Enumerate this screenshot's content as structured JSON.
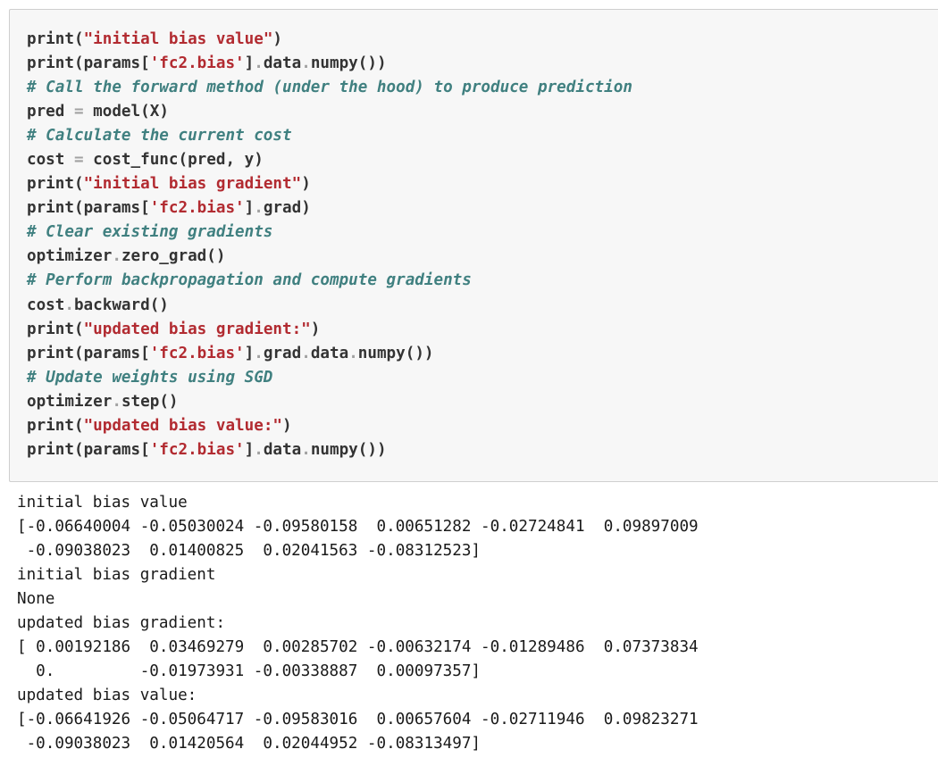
{
  "code_cell": {
    "lines": [
      [
        {
          "t": "n",
          "v": "print"
        },
        {
          "t": "p",
          "v": "("
        },
        {
          "t": "s",
          "v": "\"initial bias value\""
        },
        {
          "t": "p",
          "v": ")"
        }
      ],
      [
        {
          "t": "n",
          "v": "print"
        },
        {
          "t": "p",
          "v": "("
        },
        {
          "t": "n",
          "v": "params"
        },
        {
          "t": "p",
          "v": "["
        },
        {
          "t": "s",
          "v": "'fc2.bias'"
        },
        {
          "t": "p",
          "v": "]"
        },
        {
          "t": "o",
          "v": "."
        },
        {
          "t": "n",
          "v": "data"
        },
        {
          "t": "o",
          "v": "."
        },
        {
          "t": "n",
          "v": "numpy"
        },
        {
          "t": "p",
          "v": "())"
        }
      ],
      [
        {
          "t": "c",
          "v": "# Call the forward method (under the hood) to produce prediction"
        }
      ],
      [
        {
          "t": "n",
          "v": "pred "
        },
        {
          "t": "o",
          "v": "="
        },
        {
          "t": "n",
          "v": " model"
        },
        {
          "t": "p",
          "v": "("
        },
        {
          "t": "n",
          "v": "X"
        },
        {
          "t": "p",
          "v": ")"
        }
      ],
      [
        {
          "t": "c",
          "v": "# Calculate the current cost"
        }
      ],
      [
        {
          "t": "n",
          "v": "cost "
        },
        {
          "t": "o",
          "v": "="
        },
        {
          "t": "n",
          "v": " cost_func"
        },
        {
          "t": "p",
          "v": "("
        },
        {
          "t": "n",
          "v": "pred"
        },
        {
          "t": "p",
          "v": ", "
        },
        {
          "t": "n",
          "v": "y"
        },
        {
          "t": "p",
          "v": ")"
        }
      ],
      [
        {
          "t": "n",
          "v": "print"
        },
        {
          "t": "p",
          "v": "("
        },
        {
          "t": "s",
          "v": "\"initial bias gradient\""
        },
        {
          "t": "p",
          "v": ")"
        }
      ],
      [
        {
          "t": "n",
          "v": "print"
        },
        {
          "t": "p",
          "v": "("
        },
        {
          "t": "n",
          "v": "params"
        },
        {
          "t": "p",
          "v": "["
        },
        {
          "t": "s",
          "v": "'fc2.bias'"
        },
        {
          "t": "p",
          "v": "]"
        },
        {
          "t": "o",
          "v": "."
        },
        {
          "t": "n",
          "v": "grad"
        },
        {
          "t": "p",
          "v": ")"
        }
      ],
      [
        {
          "t": "c",
          "v": "# Clear existing gradients"
        }
      ],
      [
        {
          "t": "n",
          "v": "optimizer"
        },
        {
          "t": "o",
          "v": "."
        },
        {
          "t": "n",
          "v": "zero_grad"
        },
        {
          "t": "p",
          "v": "()"
        }
      ],
      [
        {
          "t": "c",
          "v": "# Perform backpropagation and compute gradients"
        }
      ],
      [
        {
          "t": "n",
          "v": "cost"
        },
        {
          "t": "o",
          "v": "."
        },
        {
          "t": "n",
          "v": "backward"
        },
        {
          "t": "p",
          "v": "()"
        }
      ],
      [
        {
          "t": "n",
          "v": "print"
        },
        {
          "t": "p",
          "v": "("
        },
        {
          "t": "s",
          "v": "\"updated bias gradient:\""
        },
        {
          "t": "p",
          "v": ")"
        }
      ],
      [
        {
          "t": "n",
          "v": "print"
        },
        {
          "t": "p",
          "v": "("
        },
        {
          "t": "n",
          "v": "params"
        },
        {
          "t": "p",
          "v": "["
        },
        {
          "t": "s",
          "v": "'fc2.bias'"
        },
        {
          "t": "p",
          "v": "]"
        },
        {
          "t": "o",
          "v": "."
        },
        {
          "t": "n",
          "v": "grad"
        },
        {
          "t": "o",
          "v": "."
        },
        {
          "t": "n",
          "v": "data"
        },
        {
          "t": "o",
          "v": "."
        },
        {
          "t": "n",
          "v": "numpy"
        },
        {
          "t": "p",
          "v": "())"
        }
      ],
      [
        {
          "t": "c",
          "v": "# Update weights using SGD"
        }
      ],
      [
        {
          "t": "n",
          "v": "optimizer"
        },
        {
          "t": "o",
          "v": "."
        },
        {
          "t": "n",
          "v": "step"
        },
        {
          "t": "p",
          "v": "()"
        }
      ],
      [
        {
          "t": "n",
          "v": "print"
        },
        {
          "t": "p",
          "v": "("
        },
        {
          "t": "s",
          "v": "\"updated bias value:\""
        },
        {
          "t": "p",
          "v": ")"
        }
      ],
      [
        {
          "t": "n",
          "v": "print"
        },
        {
          "t": "p",
          "v": "("
        },
        {
          "t": "n",
          "v": "params"
        },
        {
          "t": "p",
          "v": "["
        },
        {
          "t": "s",
          "v": "'fc2.bias'"
        },
        {
          "t": "p",
          "v": "]"
        },
        {
          "t": "o",
          "v": "."
        },
        {
          "t": "n",
          "v": "data"
        },
        {
          "t": "o",
          "v": "."
        },
        {
          "t": "n",
          "v": "numpy"
        },
        {
          "t": "p",
          "v": "())"
        }
      ]
    ]
  },
  "output_cell": {
    "lines": [
      "initial bias value",
      "[-0.06640004 -0.05030024 -0.09580158  0.00651282 -0.02724841  0.09897009",
      " -0.09038023  0.01400825  0.02041563 -0.08312523]",
      "initial bias gradient",
      "None",
      "updated bias gradient:",
      "[ 0.00192186  0.03469279  0.00285702 -0.00632174 -0.01289486  0.07373834",
      "  0.         -0.01973931 -0.00338887  0.00097357]",
      "updated bias value:",
      "[-0.06641926 -0.05064717 -0.09583016  0.00657604 -0.02711946  0.09823271",
      " -0.09038023  0.01420564  0.02044952 -0.08313497]"
    ]
  },
  "colors": {
    "cell_background": "#f7f7f7",
    "cell_border": "#cfcfcf",
    "string": "#b22b31",
    "comment": "#408080",
    "operator": "#a2a2a2",
    "text": "#333333"
  }
}
